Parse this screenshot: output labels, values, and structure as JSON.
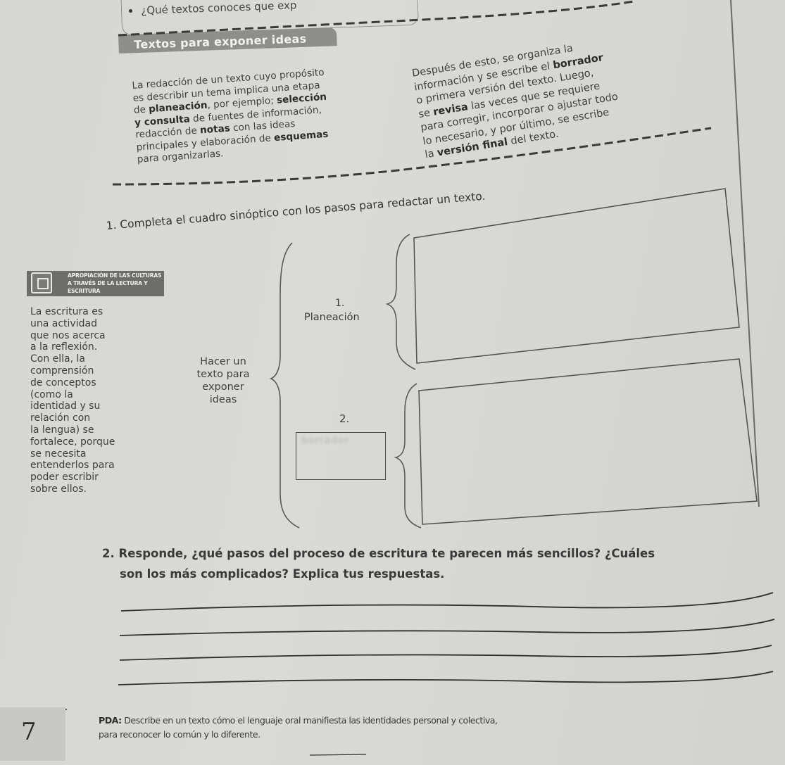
{
  "top_question": {
    "bullet": "•",
    "text": "¿Qué textos conoces que exp"
  },
  "section": {
    "title": "Textos para exponer ideas"
  },
  "intro_left": {
    "lines": [
      "La redacción de un texto cuyo propósito",
      "es describir un tema implica una etapa",
      "de |planeación|, por ejemplo; |selección|",
      "|y consulta| de fuentes de información,",
      "redacción de |notas| con las ideas",
      "principales y elaboración de |esquemas|",
      "para organizarlas."
    ],
    "bold_terms": [
      "planeación",
      "selección",
      "y consulta",
      "notas",
      "esquemas"
    ]
  },
  "intro_right": {
    "lines": [
      "Después de esto, se organiza la",
      "información y se escribe el |borrador|",
      "o primera versión del texto. Luego,",
      "se |revisa| las veces que se requiere",
      "para corregir, incorporar o ajustar todo",
      "lo necesario, y por último, se escribe",
      "la |versión final| del texto."
    ],
    "bold_terms": [
      "borrador",
      "revisa",
      "versión final"
    ]
  },
  "activity1": {
    "prompt": "1.  Completa el cuadro sinóptico con los pasos para redactar un texto.",
    "root_label": "Hacer un\ntexto para\nexponer\nideas",
    "steps": [
      {
        "number": "1.",
        "label": "Planeación",
        "answer": ""
      },
      {
        "number": "2.",
        "label": "",
        "erased_pencil": "borrador",
        "answer": ""
      }
    ]
  },
  "badge": {
    "icon": "book-screen-icon",
    "text": "Apropiación de las culturas a través de la lectura y escritura"
  },
  "sidebar_note": {
    "text": "La escritura es\nuna actividad\nque nos acerca\na la reflexión.\nCon ella, la\ncomprensión\nde conceptos\n(como la\nidentidad y su\nrelación con\nla lengua) se\nfortalece, porque\nse necesita\nentenderlos para\npoder escribir\nsobre ellos."
  },
  "activity2": {
    "prompt_line1": "2.  Responde, ¿qué pasos del proceso de escritura te parecen más sencillos? ¿Cuáles",
    "prompt_line2": "son los más complicados? Explica tus respuestas.",
    "answer_lines": [
      "",
      "",
      "",
      ""
    ]
  },
  "footer": {
    "pda_label": "PDA:",
    "pda_text_line1": " Describe en un texto cómo el lenguaje oral manifiesta las identidades personal y colectiva,",
    "pda_text_line2": "para reconocer lo común y lo diferente.",
    "page_number": "7"
  }
}
